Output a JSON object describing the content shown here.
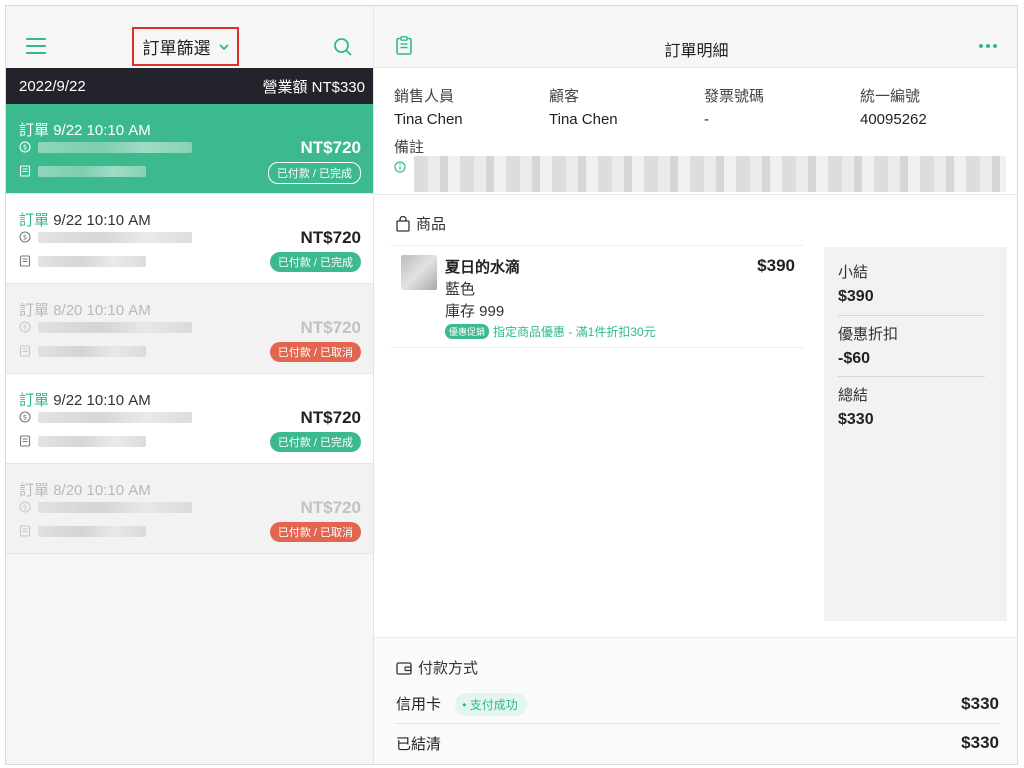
{
  "left_panel": {
    "filter_label": "訂單篩選",
    "date_bar": {
      "date": "2022/9/22",
      "revenue": "營業額 NT$330"
    },
    "orders": [
      {
        "label": "訂單",
        "time": "9/22 10:10 AM",
        "amount": "NT$720",
        "status": "已付款 / 已完成",
        "state": "active"
      },
      {
        "label": "訂單",
        "time": "9/22 10:10 AM",
        "amount": "NT$720",
        "status": "已付款 / 已完成",
        "state": "done"
      },
      {
        "label": "訂單",
        "time": "8/20 10:10 AM",
        "amount": "NT$720",
        "status": "已付款 / 已取消",
        "state": "cancelled"
      },
      {
        "label": "訂單",
        "time": "9/22 10:10 AM",
        "amount": "NT$720",
        "status": "已付款 / 已完成",
        "state": "done"
      },
      {
        "label": "訂單",
        "time": "8/20 10:10 AM",
        "amount": "NT$720",
        "status": "已付款 / 已取消",
        "state": "cancelled"
      }
    ]
  },
  "right_panel": {
    "title": "訂單明細",
    "info": {
      "sales_label": "銷售人員",
      "sales_value": "Tina Chen",
      "customer_label": "顧客",
      "customer_value": "Tina Chen",
      "invoice_label": "發票號碼",
      "invoice_value": "-",
      "tax_id_label": "統一編號",
      "tax_id_value": "40095262",
      "note_label": "備註"
    },
    "products": {
      "section_label": "商品",
      "items": [
        {
          "name": "夏日的水滴",
          "variant": "藍色",
          "stock": "庫存 999",
          "price": "$390",
          "promo_tag": "優惠促銷",
          "promo_text": "指定商品優惠 - 滿1件折扣30元"
        }
      ]
    },
    "summary": {
      "subtotal_label": "小結",
      "subtotal_value": "$390",
      "discount_label": "優惠折扣",
      "discount_value": "-$60",
      "total_label": "總結",
      "total_value": "$330"
    },
    "payment": {
      "section_label": "付款方式",
      "method": "信用卡",
      "method_status": "支付成功",
      "method_amount": "$330",
      "settled_label": "已結清",
      "settled_amount": "$330"
    }
  },
  "colors": {
    "accent": "#3dba8d",
    "cancel": "#e2654f",
    "header_dark": "#23232b",
    "highlight_border": "#e0302a"
  },
  "icons": [
    "menu-icon",
    "chevron-down-icon",
    "search-icon",
    "dollar-icon",
    "receipt-icon",
    "clipboard-icon",
    "more-icon",
    "info-icon",
    "shopping-bag-icon",
    "wallet-icon"
  ]
}
